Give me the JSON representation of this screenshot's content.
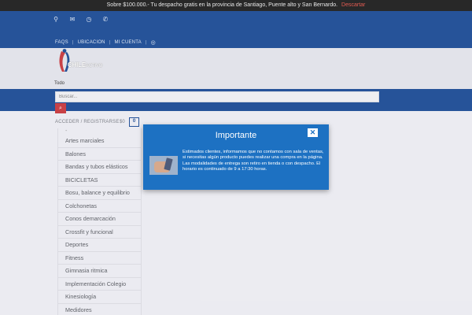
{
  "topbar": {
    "message": "Sobre $100.000.- Tu despacho gratis en la provincia de Santiago, Puente alto y San Bernardo.",
    "dismiss": "Descartar"
  },
  "header": {
    "contact_icons": [
      {
        "name": "location-icon",
        "glyph": "⚲"
      },
      {
        "name": "mail-icon",
        "glyph": "✉"
      },
      {
        "name": "clock-icon",
        "glyph": "◷"
      },
      {
        "name": "phone-icon",
        "glyph": "✆"
      }
    ],
    "nav": {
      "faqs": "FAQS",
      "location": "UBICACION",
      "account": "MI CUENTA"
    }
  },
  "logo": {
    "text_bold": "CHILE",
    "text_light": "ACTIVO",
    "subtext": "Todo"
  },
  "search": {
    "placeholder": "Buscar..."
  },
  "account": {
    "login": "ACCEDER / REGISTRARSE",
    "price": "$0",
    "cart_count": "0"
  },
  "categories": {
    "dash": "-",
    "items": [
      "Artes marciales",
      "Balones",
      "Bandas y tubos elásticos",
      "BICICLETAS",
      "Bosu, balance y equilibrio",
      "Colchonetas",
      "Conos demarcación",
      "Crossfit y funcional",
      "Deportes",
      "Fitness",
      "Gimnasia ritmica",
      "Implementación Colegio",
      "Kinesiología",
      "Medidores"
    ]
  },
  "modal": {
    "title": "Importante",
    "close": "✕",
    "body": "Estimados clientes, informamos que no contamos con sala de ventas, si necesitas algún producto puedes realizar una compra en la página. Las modalidades de entrega son retiro en tienda o con despacho. El horario es continuado de 9 a 17:30 horas."
  },
  "colors": {
    "primary": "#093c8b",
    "modal": "#1d71c2",
    "accent": "#c1272d"
  }
}
